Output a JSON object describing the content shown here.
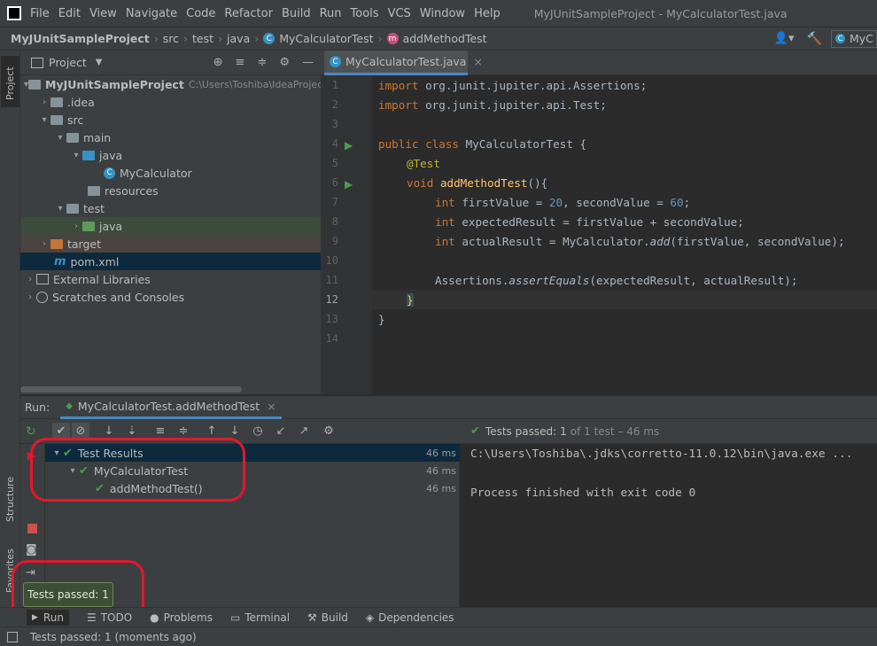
{
  "menu": [
    "File",
    "Edit",
    "View",
    "Navigate",
    "Code",
    "Refactor",
    "Build",
    "Run",
    "Tools",
    "VCS",
    "Window",
    "Help"
  ],
  "window_title": "MyJUnitSampleProject - MyCalculatorTest.java",
  "breadcrumb": {
    "project": "MyJUnitSampleProject",
    "src": "src",
    "test": "test",
    "java": "java",
    "class": "MyCalculatorTest",
    "method": "addMethodTest",
    "run_config": "MyC"
  },
  "left_tabs": {
    "project": "Project",
    "structure": "Structure",
    "favorites": "Favorites"
  },
  "project_panel": {
    "title": "Project",
    "tree": [
      {
        "label": "MyJUnitSampleProject",
        "extra": "C:\\Users\\Toshiba\\IdeaProjects\\M"
      },
      {
        "label": ".idea"
      },
      {
        "label": "src"
      },
      {
        "label": "main"
      },
      {
        "label": "java"
      },
      {
        "label": "MyCalculator"
      },
      {
        "label": "resources"
      },
      {
        "label": "test"
      },
      {
        "label": "java"
      },
      {
        "label": "target"
      },
      {
        "label": "pom.xml"
      },
      {
        "label": "External Libraries"
      },
      {
        "label": "Scratches and Consoles"
      }
    ]
  },
  "editor": {
    "tab": "MyCalculatorTest.java",
    "line_numbers": [
      "1",
      "2",
      "3",
      "4",
      "5",
      "6",
      "7",
      "8",
      "9",
      "10",
      "11",
      "12",
      "13",
      "14"
    ],
    "code": {
      "l1_kw": "import",
      "l1": " org.junit.jupiter.api.Assertions;",
      "l2_kw": "import",
      "l2": " org.junit.jupiter.api.Test;",
      "l4_kw": "public class",
      "l4": " MyCalculatorTest {",
      "l5": "@Test",
      "l6_kw": "void",
      "l6_fn": "addMethodTest",
      "l6": "(){",
      "l7_kw": "int",
      "l7a": " firstValue = ",
      "l7n1": "20",
      "l7b": ", secondValue = ",
      "l7n2": "60",
      "l7c": ";",
      "l8_kw": "int",
      "l8": " expectedResult = firstValue + secondValue;",
      "l9_kw": "int",
      "l9a": " actualResult = MyCalculator.",
      "l9_it": "add",
      "l9b": "(firstValue, secondValue);",
      "l11a": "Assertions.",
      "l11_it": "assertEquals",
      "l11b": "(expectedResult, actualResult);",
      "l12": "}",
      "l13": "}"
    }
  },
  "run_panel": {
    "label": "Run:",
    "config": "MyCalculatorTest.addMethodTest",
    "status_prefix": "Tests passed:",
    "status_count": "1",
    "status_suffix": "of 1 test – 46 ms",
    "results": [
      {
        "label": "Test Results",
        "time": "46 ms"
      },
      {
        "label": "MyCalculatorTest",
        "time": "46 ms"
      },
      {
        "label": "addMethodTest()",
        "time": "46 ms"
      }
    ],
    "console": [
      "C:\\Users\\Toshiba\\.jdks\\corretto-11.0.12\\bin\\java.exe ...",
      "",
      "Process finished with exit code 0"
    ]
  },
  "tooltip": "Tests passed: 1",
  "bottom_tabs": {
    "run": "Run",
    "todo": "TODO",
    "problems": "Problems",
    "terminal": "Terminal",
    "build": "Build",
    "dependencies": "Dependencies"
  },
  "status_bar": "Tests passed: 1 (moments ago)",
  "colors": {
    "accent": "#4a88c7",
    "pass": "#499c54",
    "highlight": "#e3182d"
  }
}
